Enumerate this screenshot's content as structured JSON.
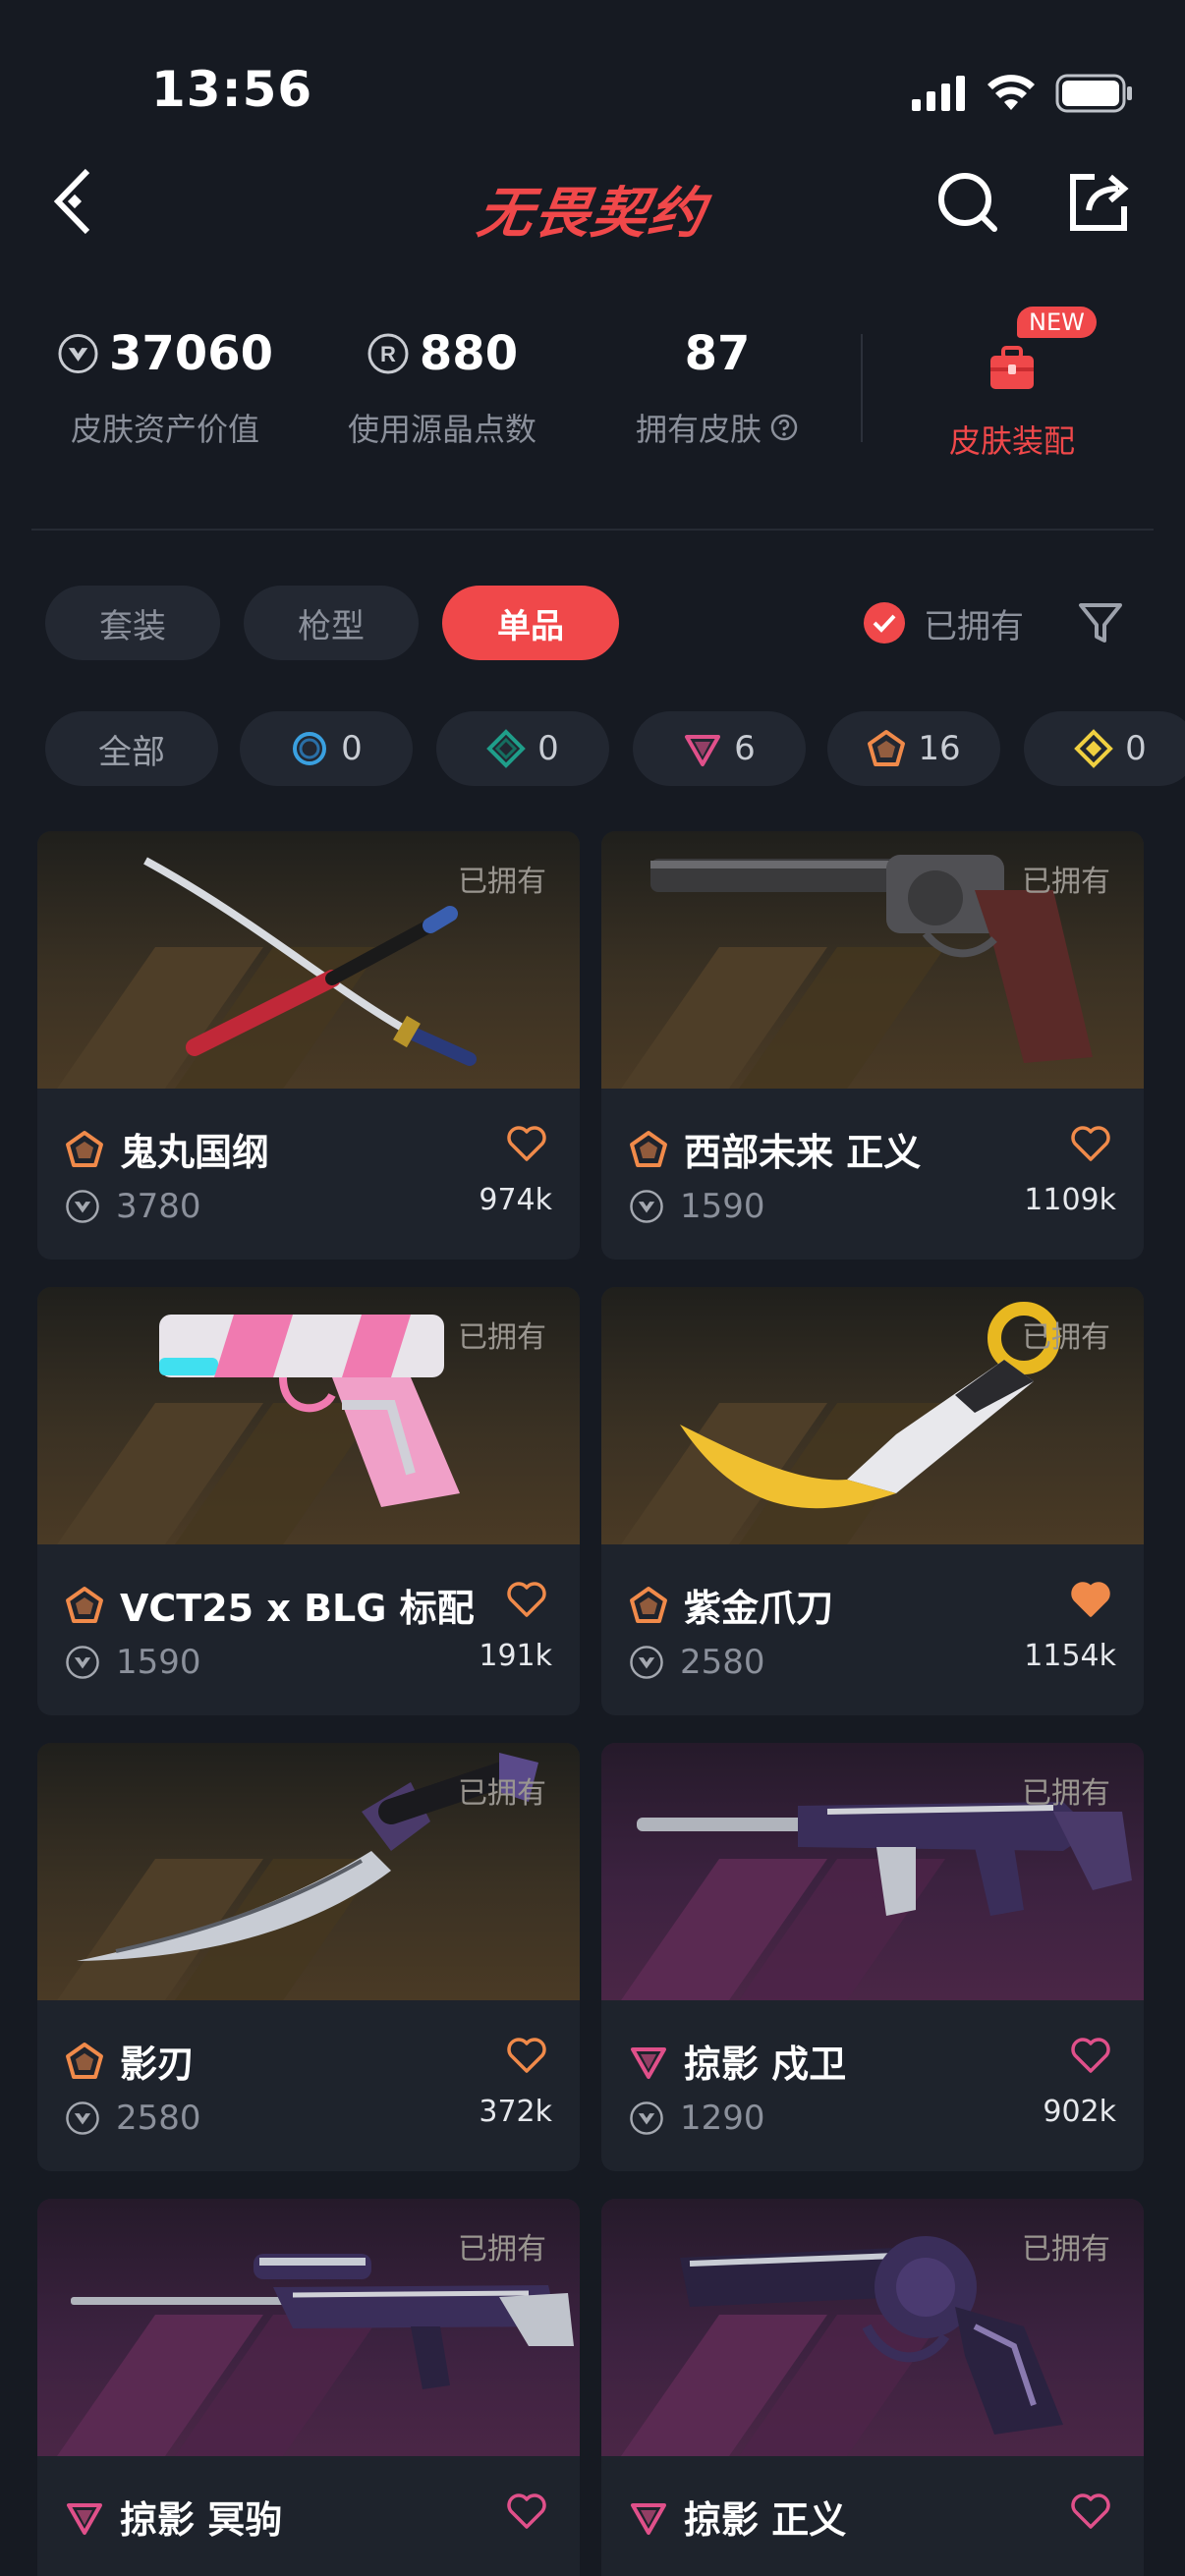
{
  "status_bar": {
    "time": "13:56"
  },
  "nav": {
    "title": "无畏契约",
    "back_icon": "chevron-left-icon",
    "search_icon": "search-icon",
    "share_icon": "share-icon"
  },
  "stats": {
    "asset_value": {
      "value": "37060",
      "label": "皮肤资产价值",
      "icon": "vp-coin-icon"
    },
    "radianite": {
      "value": "880",
      "label": "使用源晶点数",
      "icon": "radianite-icon"
    },
    "owned": {
      "value": "87",
      "label": "拥有皮肤",
      "icon": "help-circle-icon"
    },
    "equip": {
      "label": "皮肤装配",
      "badge": "NEW",
      "icon": "briefcase-icon"
    }
  },
  "tabs": [
    {
      "label": "套装",
      "active": false
    },
    {
      "label": "枪型",
      "active": false
    },
    {
      "label": "单品",
      "active": true
    }
  ],
  "owned_filter": {
    "label": "已拥有",
    "checked": true
  },
  "rarity_chips": [
    {
      "label": "全部"
    },
    {
      "count": "0",
      "icon": "select-tier-icon",
      "color": "#3aa0e0"
    },
    {
      "count": "0",
      "icon": "deluxe-tier-icon",
      "color": "#1f9e8a"
    },
    {
      "count": "6",
      "icon": "premium-tier-icon",
      "color": "#e0508a"
    },
    {
      "count": "16",
      "icon": "exclusive-tier-icon",
      "color": "#f08a4a"
    },
    {
      "count": "0",
      "icon": "ultra-tier-icon",
      "color": "#f0d040"
    }
  ],
  "colors": {
    "accent": "#f0484a",
    "exclusive": "#f08a4a",
    "premium": "#e0508a",
    "heart_liked": "#f08a4a",
    "heart_premium": "#e0508a"
  },
  "cards": [
    {
      "name": "鬼丸国纲",
      "price": "3780",
      "likes": "974k",
      "owned": "已拥有",
      "tier": "exclusive",
      "liked": false,
      "weapon": "katana"
    },
    {
      "name": "西部未来 正义",
      "price": "1590",
      "likes": "1109k",
      "owned": "已拥有",
      "tier": "exclusive",
      "liked": false,
      "weapon": "revolver"
    },
    {
      "name": "VCT25 x BLG 标配",
      "price": "1590",
      "likes": "191k",
      "owned": "已拥有",
      "tier": "exclusive",
      "liked": false,
      "weapon": "pistol"
    },
    {
      "name": "紫金爪刀",
      "price": "2580",
      "likes": "1154k",
      "owned": "已拥有",
      "tier": "exclusive",
      "liked": true,
      "weapon": "karambit"
    },
    {
      "name": "影刃",
      "price": "2580",
      "likes": "372k",
      "owned": "已拥有",
      "tier": "exclusive",
      "liked": false,
      "weapon": "dagger"
    },
    {
      "name": "掠影 戍卫",
      "price": "1290",
      "likes": "902k",
      "owned": "已拥有",
      "tier": "premium",
      "liked": false,
      "weapon": "rifle"
    },
    {
      "name": "掠影 冥驹",
      "price": "",
      "likes": "",
      "owned": "已拥有",
      "tier": "premium",
      "liked": false,
      "weapon": "sniper"
    },
    {
      "name": "掠影 正义",
      "price": "",
      "likes": "",
      "owned": "已拥有",
      "tier": "premium",
      "liked": false,
      "weapon": "revolver-dark"
    }
  ]
}
